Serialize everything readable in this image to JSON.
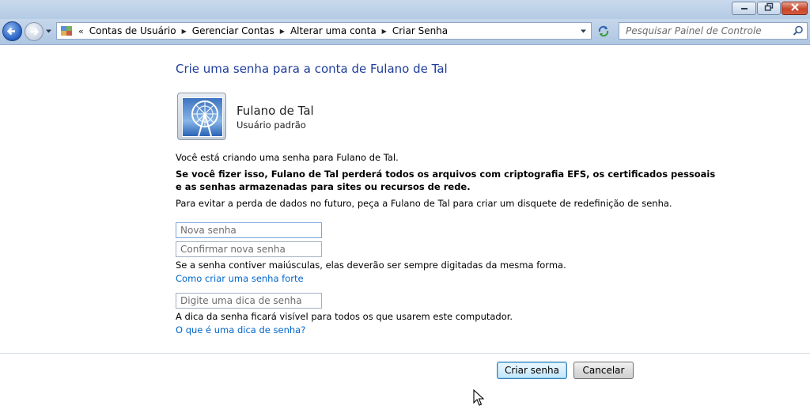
{
  "window": {
    "controls": [
      "minimize",
      "maximize",
      "close"
    ]
  },
  "navbar": {
    "breadcrumbs": [
      "Contas de Usuário",
      "Gerenciar Contas",
      "Alterar uma conta",
      "Criar Senha"
    ],
    "search_placeholder": "Pesquisar Painel de Controle"
  },
  "main": {
    "heading": "Crie uma senha para a conta de Fulano de Tal",
    "user": {
      "name": "Fulano de Tal",
      "type": "Usuário padrão"
    },
    "intro": "Você está criando uma senha para Fulano de Tal.",
    "warning_line1": "Se você fizer isso, Fulano de Tal perderá todos os arquivos com criptografia EFS, os certificados pessoais",
    "warning_line2": "e as senhas armazenadas para sites ou recursos de rede.",
    "advice": "Para evitar a perda de dados no futuro, peça a Fulano de Tal para criar um disquete de redefinição de senha.",
    "new_password_placeholder": "Nova senha",
    "confirm_password_placeholder": "Confirmar nova senha",
    "case_note": "Se a senha contiver maiúsculas, elas deverão ser sempre digitadas da mesma forma.",
    "strong_password_link": "Como criar uma senha forte",
    "hint_placeholder": "Digite uma dica de senha",
    "hint_note": "A dica da senha ficará visível para todos os que usarem este computador.",
    "hint_link": "O que é uma dica de senha?"
  },
  "footer": {
    "create_label": "Criar senha",
    "cancel_label": "Cancelar"
  }
}
